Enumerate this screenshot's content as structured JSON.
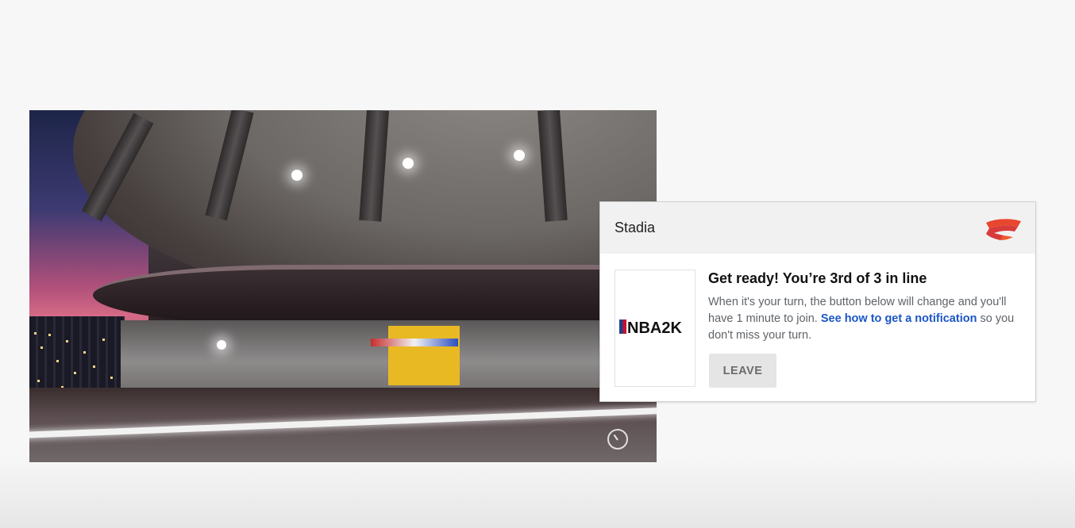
{
  "notification": {
    "app_name": "Stadia",
    "headline": "Get ready! You’re 3rd of 3 in line",
    "body_prefix": "When it's your turn, the button below will change and you'll have 1 minute to join. ",
    "link_text": "See how to get a notification",
    "body_suffix": " so you don't miss your turn.",
    "leave_button": "LEAVE",
    "game_logo_text": "NBA2K",
    "icons": [
      "stadia-logo-icon",
      "timer-icon"
    ],
    "colors": {
      "stadia_brand": "#e8472f",
      "link": "#1a56c7"
    }
  }
}
